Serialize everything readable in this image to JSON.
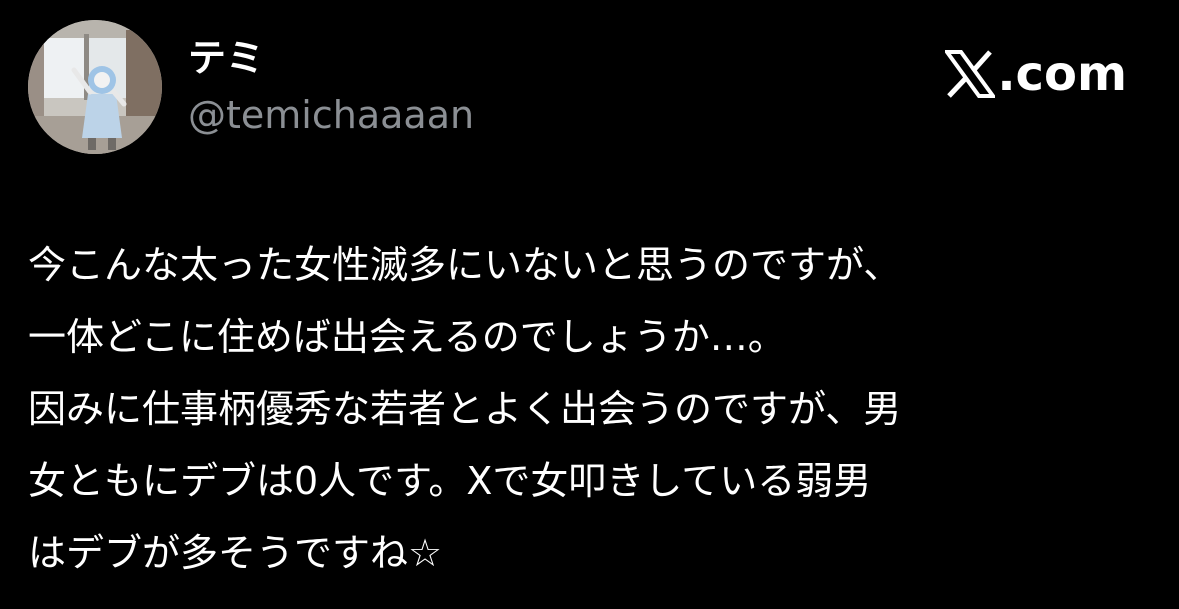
{
  "author": {
    "display_name": "テミ",
    "handle": "@temichaaaan",
    "avatar": "profile-photo"
  },
  "brand": {
    "icon": "x-logo-icon",
    "label": ".com"
  },
  "tweet": {
    "lines": [
      "今こんな太った女性滅多にいないと思うのですが、",
      "一体どこに住めば出会えるのでしょうか…。",
      "因みに仕事柄優秀な若者とよく出会うのですが、男",
      "女ともにデブは0人です。Xで女叩きしている弱男",
      "はデブが多そうですね☆"
    ]
  },
  "colors": {
    "background": "#000000",
    "text": "#ffffff",
    "secondary_text": "#8b8f94"
  }
}
